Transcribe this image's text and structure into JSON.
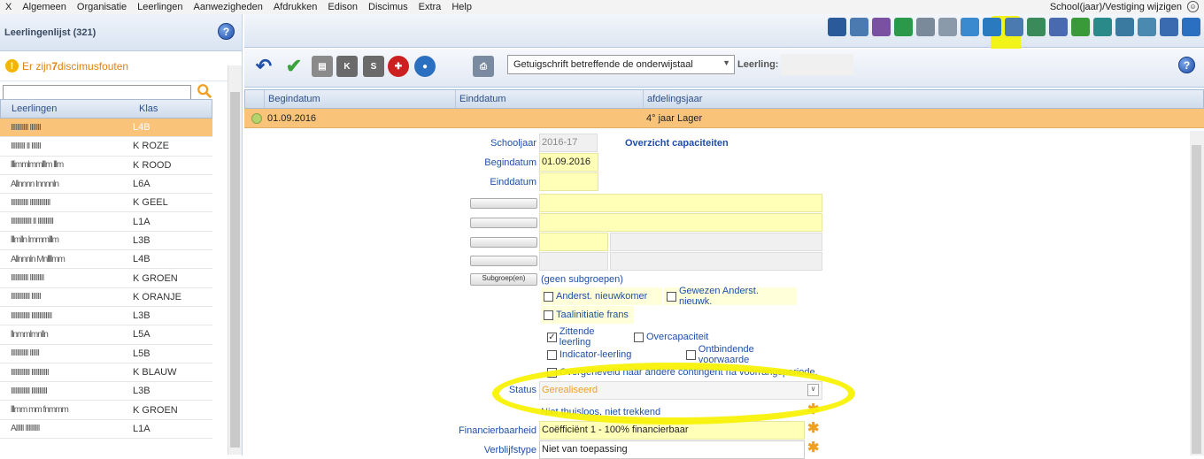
{
  "menu": {
    "items": [
      "X",
      "Algemeen",
      "Organisatie",
      "Leerlingen",
      "Aanwezigheden",
      "Afdrukken",
      "Edison",
      "Discimus",
      "Extra",
      "Help"
    ],
    "school": "School(jaar)/Vestiging wijzigen"
  },
  "left": {
    "title": "Leerlingenlijst (321)",
    "warn_prefix": "Er zijn ",
    "warn_count": "7",
    "warn_suffix": " discimusfouten",
    "search_value": "",
    "col_name": "Leerlingen",
    "col_klas": "Klas",
    "rows": [
      {
        "name": "IIIIIIIIIII IIIIIII",
        "klas": "L4B"
      },
      {
        "name": "IIIIIIIII II IIIIII",
        "klas": "K ROZE"
      },
      {
        "name": "lllimmlmmlllm lllm",
        "klas": "K ROOD"
      },
      {
        "name": "Allnnnn Innnnln",
        "klas": "L6A"
      },
      {
        "name": "IIIIIIIIIII IIIIIIIIIIIII",
        "klas": "K GEEL"
      },
      {
        "name": "IIIIIIIIIIIII II IIIIIIIIII",
        "klas": "L1A"
      },
      {
        "name": "lllmlln lmmmlllm",
        "klas": "L3B"
      },
      {
        "name": "Allnnnln Mnllllmm",
        "klas": "L4B"
      },
      {
        "name": "IIIIIIIIIII IIIIIIIII",
        "klas": "K GROEN"
      },
      {
        "name": "IIIIIIIIIIII IIIIII",
        "klas": "K ORANJE"
      },
      {
        "name": "IIIIIIIIIIII IIIIIIIIIIIII",
        "klas": "L3B"
      },
      {
        "name": "llnmmlmnlln",
        "klas": "L5A"
      },
      {
        "name": "IIIIIIIIIII IIIIII",
        "klas": "L5B"
      },
      {
        "name": "IIIIIIIIIIII IIIIIIIIIII",
        "klas": "K BLAUW"
      },
      {
        "name": "IIIIIIIIIIII IIIIIIIIII",
        "klas": "L3B"
      },
      {
        "name": "lllmm mm fnmmm",
        "klas": "K GROEN"
      },
      {
        "name": "AIIIII IIIIIIIII",
        "klas": "L1A"
      }
    ]
  },
  "toolbar2": {
    "select": "Getuigschrift betreffende de onderwijstaal",
    "leerling_label": "Leerling:"
  },
  "grid": {
    "cols": [
      "Begindatum",
      "Einddatum",
      "afdelingsjaar"
    ],
    "row": {
      "begin": "01.09.2016",
      "eind": "",
      "jaar": "4° jaar Lager"
    }
  },
  "form": {
    "schooljaar_lbl": "Schooljaar",
    "schooljaar": "2016-17",
    "capaciteit_link": "Overzicht capaciteiten",
    "begindatum_lbl": "Begindatum",
    "begindatum": "01.09.2016",
    "einddatum_lbl": "Einddatum",
    "einddatum": "",
    "subgroep_btn": "Subgroep(en)",
    "subgroep_val": "(geen subgroepen)",
    "cb1": "Anderst. nieuwkomer",
    "cb2": "Gewezen Anderst. nieuwk.",
    "cb3": "Taalinitiatie frans",
    "cb4": "Zittende leerling",
    "cb5": "Overcapaciteit",
    "cb6": "Indicator-leerling",
    "cb7": "Ontbindende voorwaarde",
    "cb8": "Overgeheveld naar andere contingent na voorrangsperiode.",
    "status_lbl": "Status",
    "status_val": "Gerealiseerd",
    "thuis": "Niet thuisloos, niet trekkend",
    "fin_lbl": "Financierbaarheid",
    "fin_val": "Coëfficiënt 1 - 100% financierbaar",
    "verb_lbl": "Verblijfstype",
    "verb_val": "Niet van toepassing"
  },
  "colors": {
    "accent": "#1f4fa8",
    "selected": "#f9c47a",
    "field": "#ffffb8",
    "highlight": "#f7f200"
  }
}
